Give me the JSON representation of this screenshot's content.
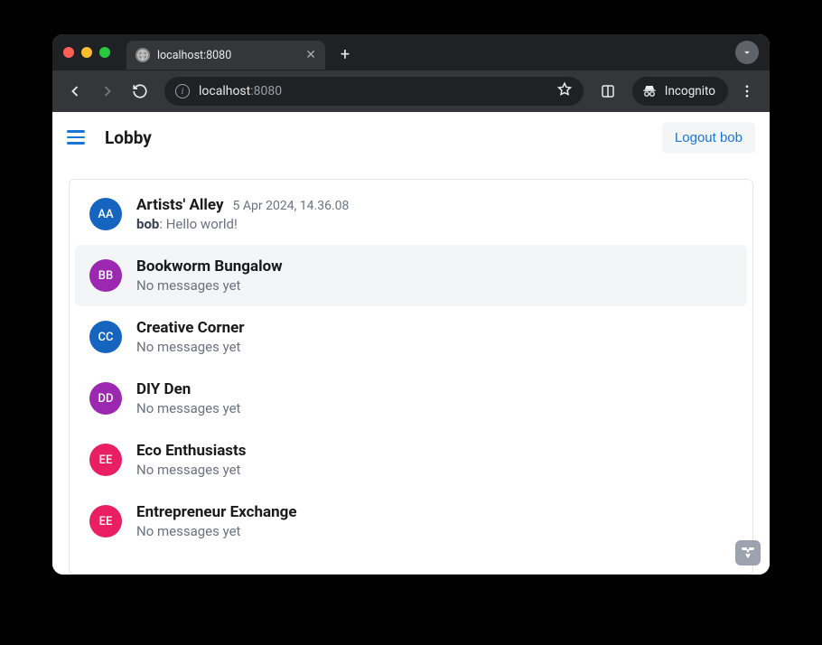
{
  "browser": {
    "tab_title": "localhost:8080",
    "url_host": "localhost",
    "url_path": ":8080",
    "incognito_label": "Incognito"
  },
  "header": {
    "title": "Lobby",
    "logout_label": "Logout bob"
  },
  "rooms": [
    {
      "initials": "AA",
      "color": "#1565c0",
      "name": "Artists' Alley",
      "timestamp": "5 Apr 2024, 14.36.08",
      "last_author": "bob",
      "last_message": "Hello world!",
      "empty_text": null
    },
    {
      "initials": "BB",
      "color": "#9c27b0",
      "name": "Bookworm Bungalow",
      "timestamp": "",
      "last_author": null,
      "last_message": null,
      "empty_text": "No messages yet"
    },
    {
      "initials": "CC",
      "color": "#1565c0",
      "name": "Creative Corner",
      "timestamp": "",
      "last_author": null,
      "last_message": null,
      "empty_text": "No messages yet"
    },
    {
      "initials": "DD",
      "color": "#9c27b0",
      "name": "DIY Den",
      "timestamp": "",
      "last_author": null,
      "last_message": null,
      "empty_text": "No messages yet"
    },
    {
      "initials": "EE",
      "color": "#e91e63",
      "name": "Eco Enthusiasts",
      "timestamp": "",
      "last_author": null,
      "last_message": null,
      "empty_text": "No messages yet"
    },
    {
      "initials": "EE",
      "color": "#e91e63",
      "name": "Entrepreneur Exchange",
      "timestamp": "",
      "last_author": null,
      "last_message": null,
      "empty_text": "No messages yet"
    }
  ]
}
